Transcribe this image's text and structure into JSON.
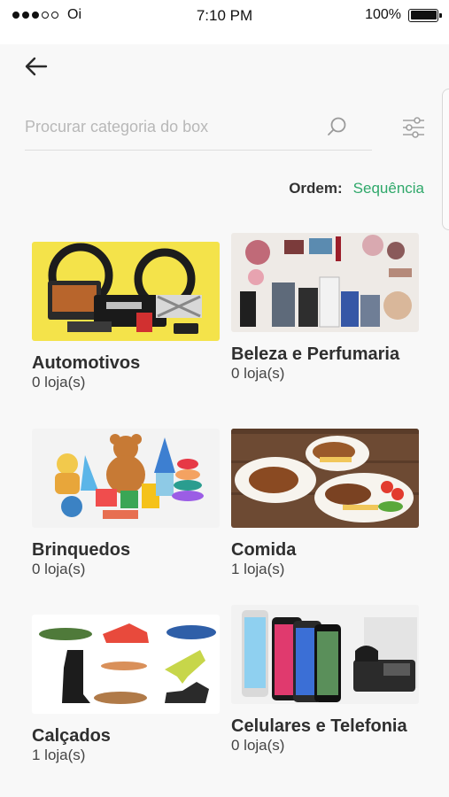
{
  "status_bar": {
    "carrier": "Oi",
    "time": "7:10 PM",
    "battery": "100%",
    "signal_bars_filled": 3,
    "signal_bars_total": 5
  },
  "header": {
    "back_icon": "arrow-left-icon"
  },
  "search": {
    "placeholder": "Procurar categoria do box",
    "value": "",
    "search_icon": "search-icon",
    "filter_icon": "sliders-icon"
  },
  "order": {
    "label": "Ordem:",
    "value": "Sequência"
  },
  "colors": {
    "accent": "#2fa86a",
    "background": "#f8f8f8",
    "title": "#2f2f2f"
  },
  "categories": [
    {
      "title": "Automotivos",
      "count": "0 loja(s)",
      "image": "car-audio-steering-wheels"
    },
    {
      "title": "Beleza e Perfumaria",
      "count": "0 loja(s)",
      "image": "makeup-perfumes"
    },
    {
      "title": "Brinquedos",
      "count": "0 loja(s)",
      "image": "toys-teddy-bear"
    },
    {
      "title": "Comida",
      "count": "1 loja(s)",
      "image": "food-plates"
    },
    {
      "title": "Calçados",
      "count": "1 loja(s)",
      "image": "shoes-collection"
    },
    {
      "title": "Celulares e Telefonia",
      "count": "0 loja(s)",
      "image": "smartphones-telephone"
    }
  ]
}
